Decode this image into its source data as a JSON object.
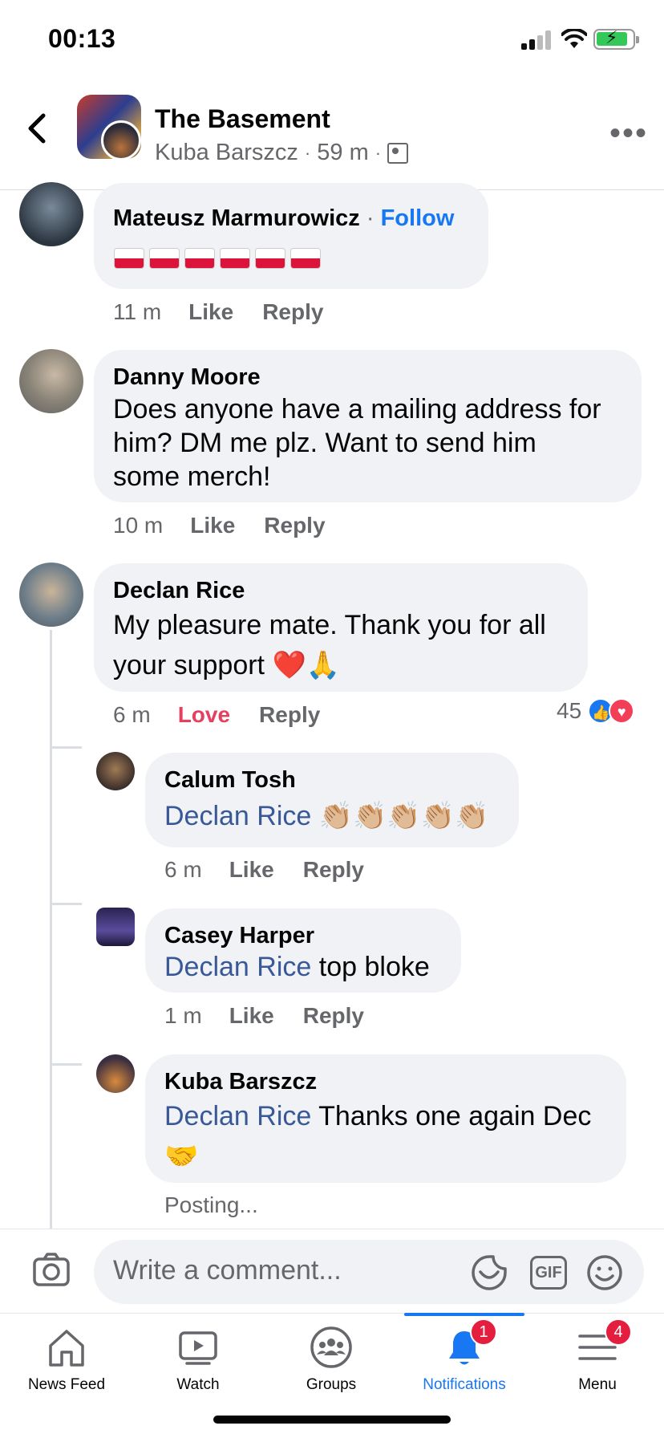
{
  "status_bar": {
    "time": "00:13"
  },
  "header": {
    "title": "The Basement",
    "author": "Kuba Barszcz",
    "time_ago": "59 m",
    "separator": "·"
  },
  "comments": [
    {
      "name": "Mateusz Marmurowicz",
      "follow_label": "Follow",
      "flags_count": 6,
      "time": "11 m",
      "like": "Like",
      "reply": "Reply"
    },
    {
      "name": "Danny Moore",
      "text_line1": "Does anyone have a mailing address for",
      "text_line2": "him? DM me plz. Want to send him",
      "text_line3": "some merch!",
      "time": "10 m",
      "like": "Like",
      "reply": "Reply"
    },
    {
      "name": "Declan Rice",
      "text_line1": "My pleasure mate. Thank you for all",
      "text_line2": "your support ❤️🙏",
      "time": "6 m",
      "reaction": "Love",
      "reply": "Reply",
      "reaction_count": "45"
    }
  ],
  "replies": [
    {
      "name": "Calum Tosh",
      "tag": "Declan Rice",
      "text": "👏🏼👏🏼👏🏼👏🏼👏🏼",
      "time": "6 m",
      "like": "Like",
      "reply": "Reply"
    },
    {
      "name": "Casey Harper",
      "tag": "Declan Rice",
      "text": "top bloke",
      "time": "1 m",
      "like": "Like",
      "reply": "Reply"
    },
    {
      "name": "Kuba Barszcz",
      "tag": "Declan Rice",
      "text": "Thanks one again Dec",
      "emoji": "🤝",
      "status": "Posting..."
    }
  ],
  "composer": {
    "placeholder": "Write a comment...",
    "gif_label": "GIF"
  },
  "tabs": [
    {
      "label": "News Feed"
    },
    {
      "label": "Watch"
    },
    {
      "label": "Groups"
    },
    {
      "label": "Notifications",
      "badge": "1"
    },
    {
      "label": "Menu",
      "badge": "4"
    }
  ],
  "colors": {
    "accent": "#1877f2",
    "love": "#e4405f",
    "bubble": "#f0f2f5",
    "muted": "#65676b"
  }
}
